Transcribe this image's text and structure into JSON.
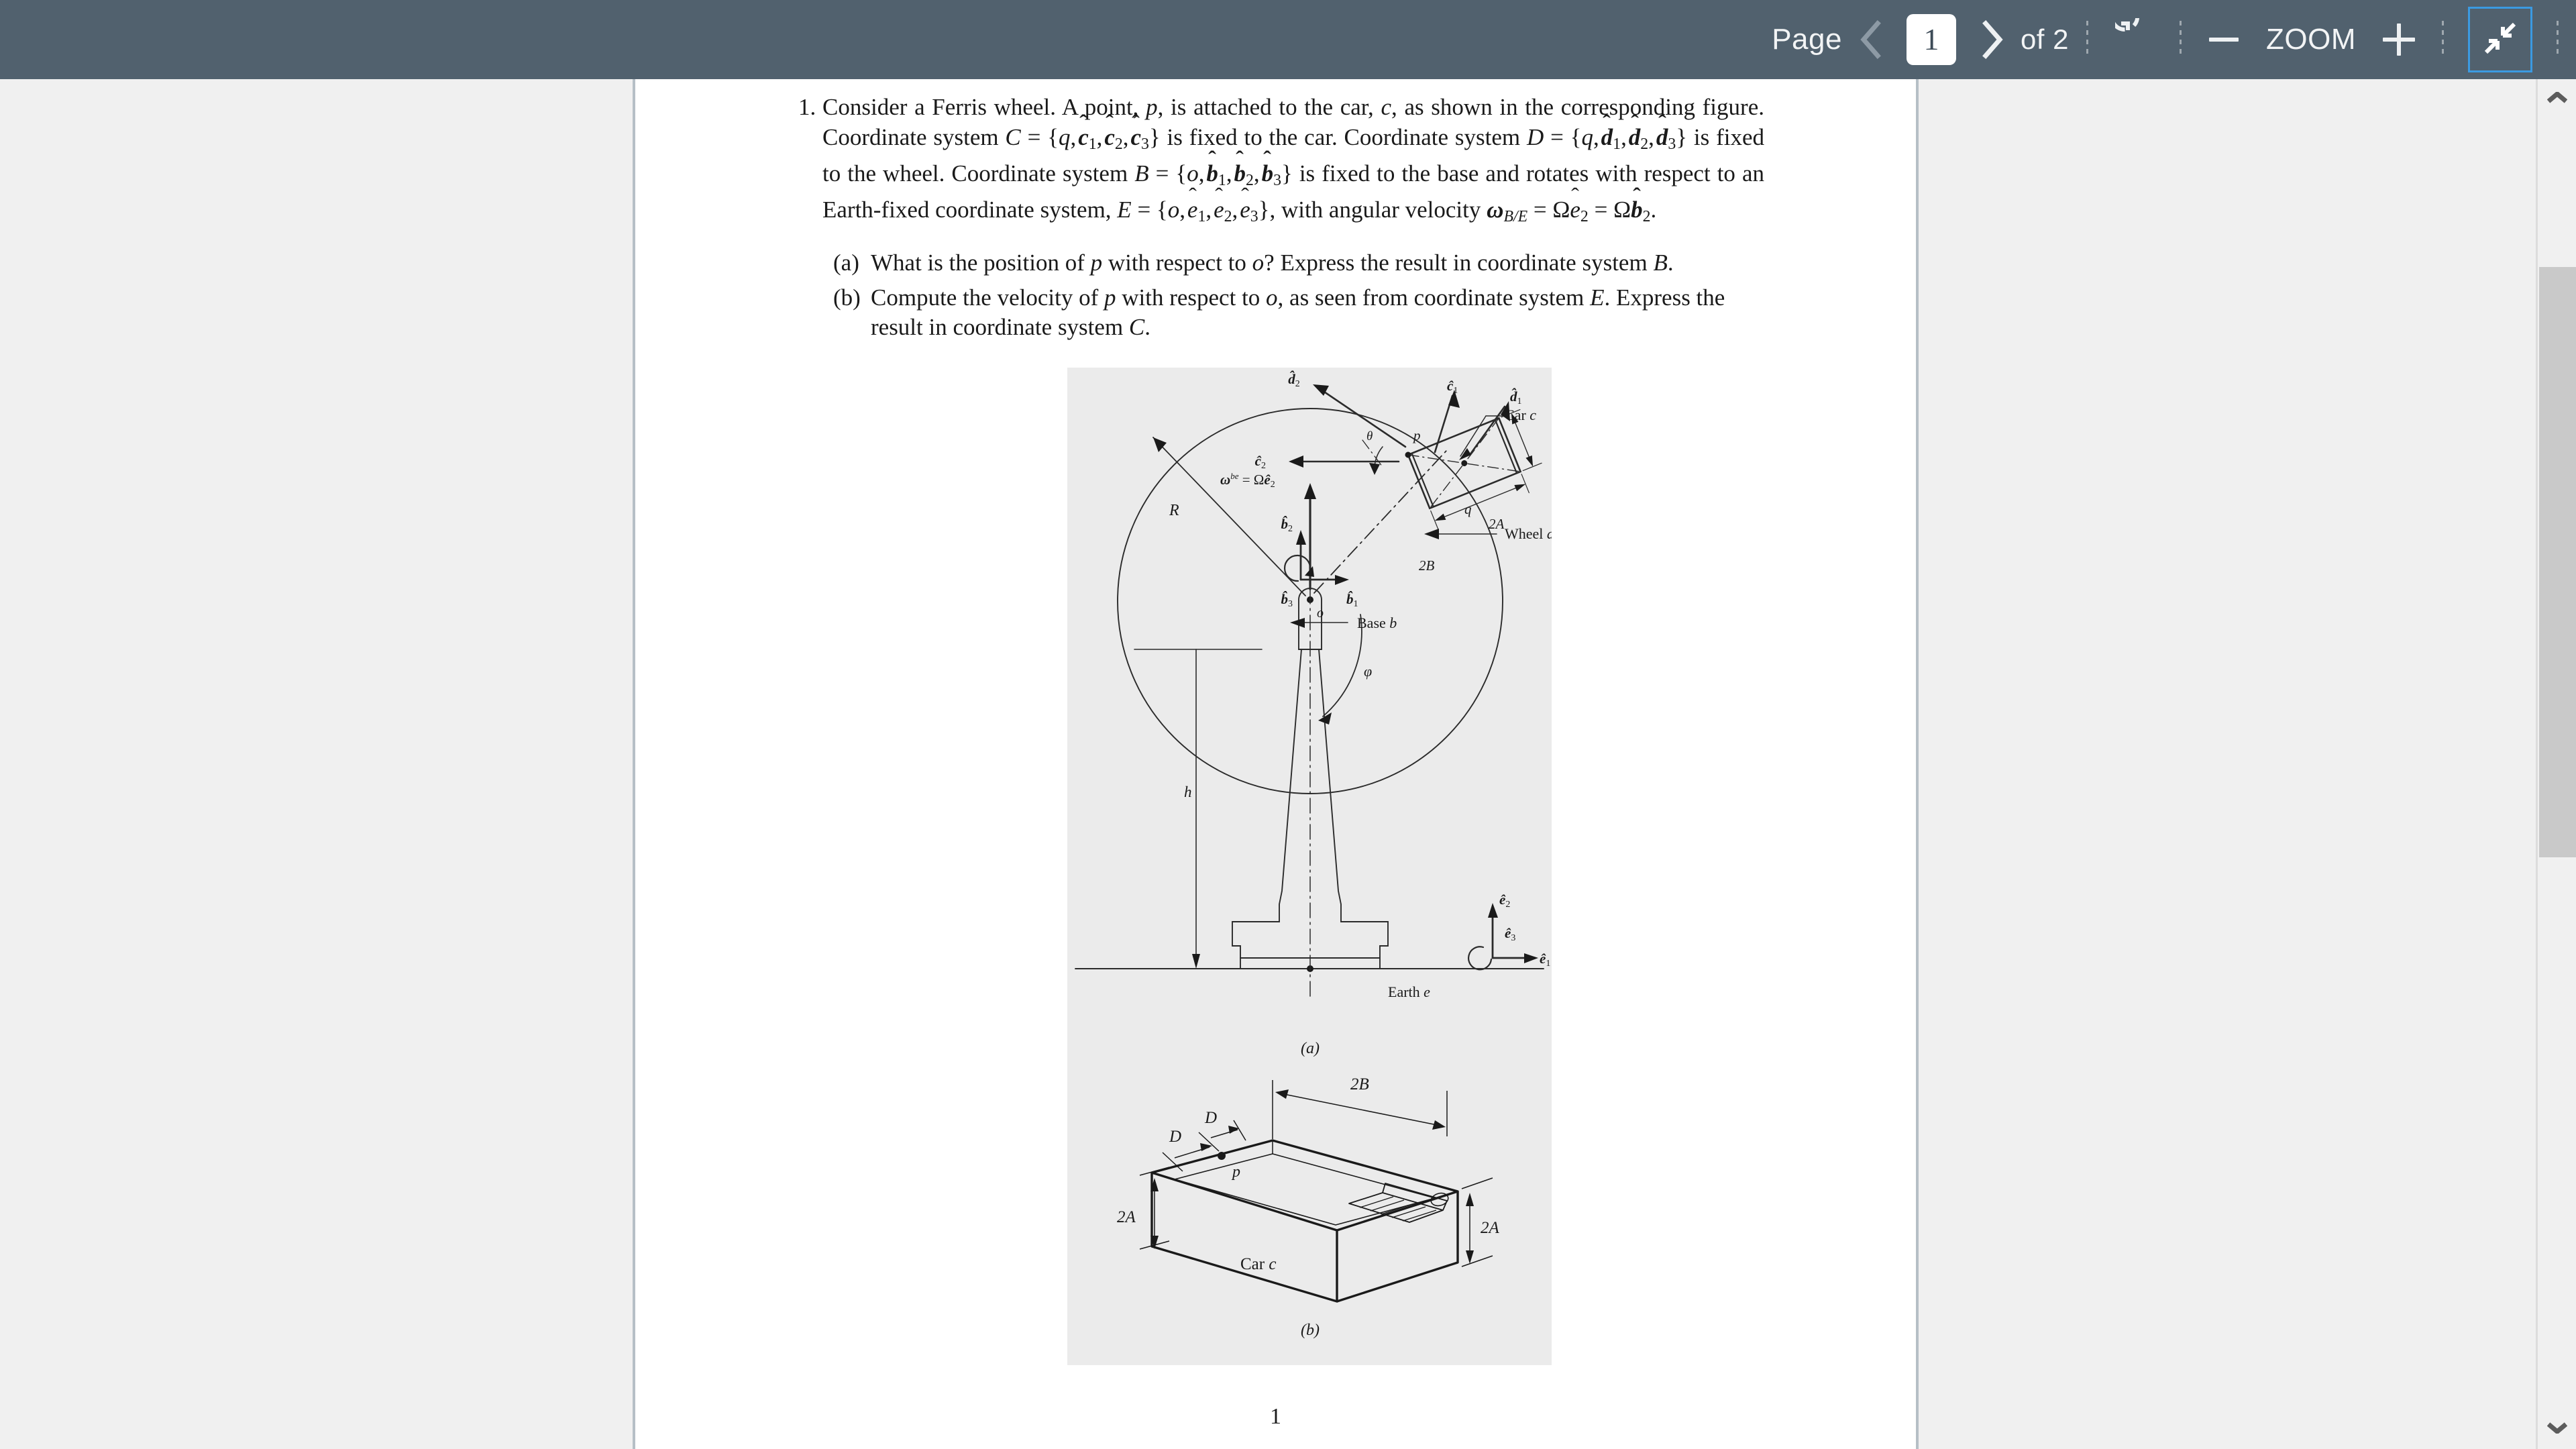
{
  "toolbar": {
    "page_label": "Page",
    "prev_icon": "chevron-left-icon",
    "page_value": "1",
    "next_icon": "chevron-right-icon",
    "of_label": "of 2",
    "rotate_icon": "rotate-icon",
    "zoom_out_icon": "minus-icon",
    "zoom_label": "ZOOM",
    "zoom_in_icon": "plus-icon",
    "fullscreen_icon": "exit-fullscreen-icon",
    "accent_color": "#3b9ae1",
    "bar_color": "#51616e"
  },
  "document": {
    "problem_number": "1.",
    "problem_text_segments": {
      "s1": "Consider a Ferris wheel. A point, ",
      "p": "p",
      "s2": ", is attached to the car, ",
      "c": "c",
      "s3": ", as shown in the corresponding figure.  Coordinate system ",
      "calC": "C",
      "eq1": " = {",
      "q": "q",
      "c1": "c",
      "sub1": "1",
      "c2": "c",
      "sub2": "2",
      "c3": "c",
      "sub3": "3",
      "s4": "} is fixed to the car.  Coordinate system ",
      "calD": "D",
      "d1": "d",
      "d2": "d",
      "d3": "d",
      "s5": "} is fixed to the wheel. Coordinate system ",
      "calB": "B",
      "o": "o",
      "b1": "b",
      "b2": "b",
      "b3": "b",
      "s6": "} is fixed to the base and rotates with respect to an Earth-fixed coordinate system, ",
      "calE": "E",
      "e1": "e",
      "e2": "e",
      "e3": "e",
      "s7": "}, with angular velocity ",
      "omega": "ω",
      "omega_sub": "B/E",
      "s8": " = Ω",
      "s9": " = Ω",
      "s10": "."
    },
    "subitems": [
      {
        "label": "(a)",
        "text_a": "What is the position of ",
        "p": "p",
        "text_b": " with respect to ",
        "o": "o",
        "text_c": "? Express the result in coordinate system ",
        "sys": "B",
        "text_d": "."
      },
      {
        "label": "(b)",
        "text_a": "Compute the velocity of ",
        "p": "p",
        "text_b": " with respect to ",
        "o": "o",
        "text_c": ", as seen from coordinate system ",
        "sys": "E",
        "text_d": ". Express the result in coordinate system ",
        "sys2": "C",
        "text_e": "."
      }
    ],
    "folio": "1"
  },
  "figure": {
    "panel_a_caption": "(a)",
    "panel_b_caption": "(b)",
    "labels_a": {
      "d2": "d",
      "d2_sub": "2",
      "c1": "c",
      "c1_sub": "1",
      "d1": "d",
      "d1_sub": "1",
      "c2": "c",
      "c2_sub": "2",
      "theta": "θ",
      "p": "p",
      "q": "q",
      "car": "Car",
      "car_it": "c",
      "twoA": "2A",
      "twoB": "2B",
      "omega_be": "ω",
      "omega_sup": "be",
      "omega_eq": " =  Ω",
      "e2": "e",
      "e2_sub": "2",
      "R": "R",
      "o": "o",
      "phi": "φ",
      "wheel": "Wheel",
      "wheel_it": "d",
      "b2": "b",
      "b2_sub": "2",
      "b1": "b",
      "b1_sub": "1",
      "b3": "b",
      "b3_sub": "3",
      "h": "h",
      "base": "Base",
      "base_it": "b",
      "earth": "Earth",
      "earth_it": "e",
      "eh2": "e",
      "eh2_sub": "2",
      "eh3": "e",
      "eh3_sub": "3",
      "eh1": "e",
      "eh1_sub": "1"
    },
    "labels_b": {
      "D1": "D",
      "D2": "D",
      "p": "p",
      "twoB": "2B",
      "twoA_left": "2A",
      "twoA_right": "2A",
      "car": "Car",
      "car_it": "c"
    }
  },
  "scrollbar": {
    "up_icon": "chevron-up-icon",
    "down_icon": "chevron-down-icon",
    "thumb": "scrollbar-thumb"
  }
}
